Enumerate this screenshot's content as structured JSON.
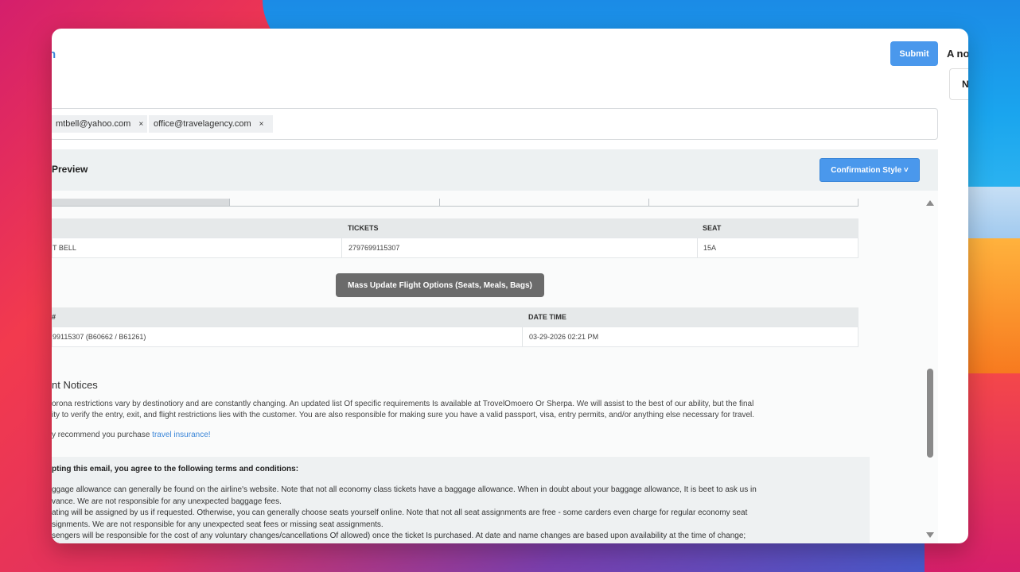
{
  "header": {
    "title_fragment": "n",
    "submit_label": "Submit",
    "side_title": "A no",
    "side_box_letter": "N"
  },
  "email_field": {
    "chips": [
      {
        "label": "mtbell@yahoo.com",
        "remove": "×"
      },
      {
        "label": "office@travelagency.com",
        "remove": "×"
      }
    ]
  },
  "preview": {
    "title": "Preview",
    "confirmation_style_label": "Confirmation Style ˅"
  },
  "passenger_table": {
    "headers": [
      "",
      "TICKETS",
      "SEAT"
    ],
    "rows": [
      [
        "T BELL",
        "2797699115307",
        "15A"
      ]
    ]
  },
  "mass_update_label": "Mass Update Flight Options (Seats, Meals, Bags)",
  "ticket_table": {
    "headers": [
      "#",
      "DATE TIME"
    ],
    "rows": [
      [
        "99115307 (B60662 / B61261)",
        "03-29-2026 02:21 PM"
      ]
    ]
  },
  "notices": {
    "title": "nt Notices",
    "line1": "orona restrictions vary by destinotiory and are constantly changing. An updated list Of specific requirements Is available at TrovelOmoero Or Sherpa. We will assist to the best of our ability, but the final",
    "line2": "ity to verify the entry, exit, and flight restrictions lies with the customer. You are also responsible for making sure you have a valid passport, visa, entry permits, and/or anything else necessary for travel.",
    "insurance_prefix": "y recommend you purchase ",
    "insurance_link": "travel insurance!"
  },
  "terms": {
    "heading": "pting this email, you agree to the following terms and conditions:",
    "lines": [
      "ggage allowance can generally be found on the airline's website. Note that not all economy class tickets have a baggage allowance. When in doubt about your baggage allowance, It is beet to ask us in",
      "vance. We are not responsible for any unexpected baggage fees.",
      "ating will be assigned by us if requested. Otherwise, you can generally choose seats yourself online. Note that not all seat assignments are free - some carders even charge for regular economy seat",
      "signments. We are not responsible for any unexpected seat fees or missing seat assignments.",
      "sengers will be responsible for the cost of any voluntary changes/cancellations Of allowed) once the ticket Is purchased. At date and name changes are based upon availability at the time of change;"
    ]
  },
  "colors": {
    "accent": "#4a98ec",
    "link": "#3b86d8",
    "mass_button": "#6b6b6b"
  }
}
